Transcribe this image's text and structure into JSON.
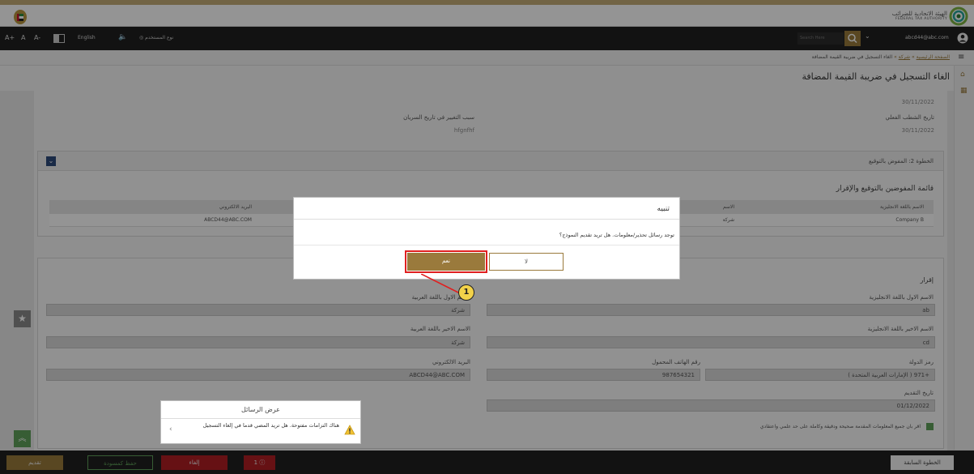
{
  "header": {
    "authority_name_ar": "الهيئة الاتحادية للضرائب",
    "authority_name_en": "FEDERAL TAX AUTHORITY"
  },
  "navbar": {
    "font_increase": "A+",
    "font_normal": "A",
    "font_decrease": "A-",
    "language": "English",
    "user_type": "نوع المستخدم",
    "search_placeholder": "Search Here",
    "user_email": "abcd44@abc.com"
  },
  "breadcrumb": {
    "home": "الصفحة الرئيسية",
    "company": "شركة",
    "current": "الغاء التسجيل في ضريبة القيمة المضافة"
  },
  "page_title": "الغاء التسجيل في ضريبة القيمة المضافة",
  "content": {
    "top_date": "30/11/2022",
    "actual_dereg_date_label": "تاريخ الشطب الفعلي",
    "actual_dereg_date_value": "30/11/2022",
    "change_reason_label": "سبب التغيير في تاريخ السريان",
    "change_reason_value": "hfgnfhf",
    "step2_title": "الخطوة 2: المفوض بالتوقيع",
    "signatories_title": "قائمة المفوضين بالتوقيع والإقرار",
    "table_headers": {
      "name_en": "الاسم باللغة الانجليزية",
      "name_ar_trunc": "الاسم",
      "email": "البريد الالكتروني"
    },
    "table_row": {
      "name_en": "Company B",
      "name_ar_trunc": "شركة",
      "email": "ABCD44@ABC.COM"
    },
    "declaration_title": "إقرار",
    "first_name_en_label": "الاسم الاول باللغة الانجليزية",
    "first_name_en_value": "ab",
    "first_name_ar_label": "الاسم الاول باللغة العربية",
    "first_name_ar_value": "شركة",
    "last_name_en_label": "الاسم الاخير باللغة الانجليزية",
    "last_name_en_value": "cd",
    "last_name_ar_label": "الاسم الاخير باللغة العربية",
    "last_name_ar_value": "شركة",
    "country_code_label": "رمز الدولة",
    "country_code_value": "+971 ( الإمارات العربية المتحدة )",
    "mobile_label": "رقم الهاتف المحمول",
    "mobile_value": "987654321",
    "email_label": "البريد الالكتروني",
    "email_value": "ABCD44@ABC.COM",
    "submission_date_label": "تاريخ التقديم",
    "submission_date_value": "01/12/2022",
    "declaration_text": "اقر بان جميع المعلومات المقدمة صحيحة ودقيقة وكاملة على حد علمي واعتقادي"
  },
  "modal": {
    "title": "تنبيه",
    "message": "توجد رسائل تحذير/معلومات. هل تريد تقديم النموذج؟",
    "yes_label": "نعم",
    "no_label": "لا",
    "callout_number": "1"
  },
  "messages_panel": {
    "title": "عرض الرسائل",
    "message": "هناك التزامات مفتوحة. هل تريد المضي قدما في إلغاء التسجيل"
  },
  "bottom_bar": {
    "submit_label": "تقديم",
    "save_draft_label": "حفظ كمسودة",
    "cancel_label": "إلغاء",
    "alert_count": "1",
    "previous_step_label": "الخطوة السابقة"
  },
  "colors": {
    "accent_gold": "#9a7a3c",
    "highlight_red": "#e02020",
    "cancel_red": "#b01e24",
    "nav_dark": "#1f1f1f"
  }
}
